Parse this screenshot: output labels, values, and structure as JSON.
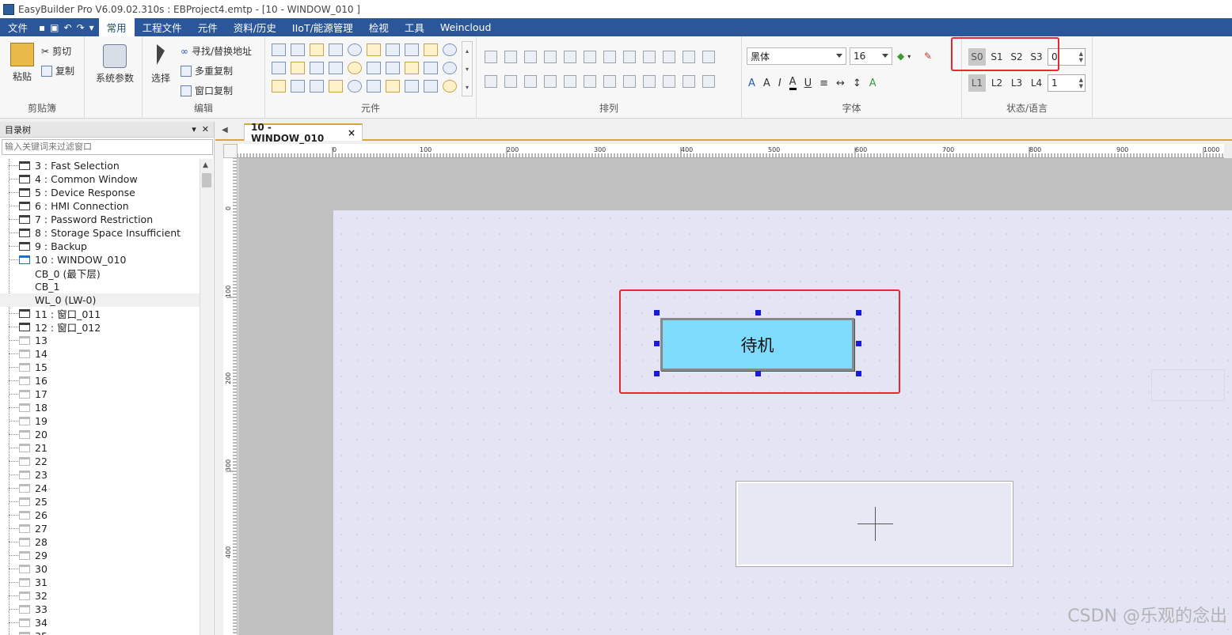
{
  "titlebar": {
    "title": "EasyBuilder Pro V6.09.02.310s : EBProject4.emtp - [10 - WINDOW_010 ]"
  },
  "menubar": {
    "file": "文件",
    "tabs": [
      {
        "label": "常用",
        "active": true
      },
      {
        "label": "工程文件"
      },
      {
        "label": "元件"
      },
      {
        "label": "资料/历史"
      },
      {
        "label": "IIoT/能源管理"
      },
      {
        "label": "检视"
      },
      {
        "label": "工具"
      },
      {
        "label": "Weincloud"
      }
    ]
  },
  "ribbon": {
    "clipboard": {
      "paste": "粘贴",
      "cut": "剪切",
      "copy": "复制",
      "label": "剪贴簿"
    },
    "system": {
      "params": "系统参数"
    },
    "edit": {
      "select": "选择",
      "find": "寻找/替换地址",
      "multi_copy": "多重复制",
      "window_copy": "窗口复制",
      "label": "编辑"
    },
    "objects": {
      "label": "元件"
    },
    "arrange": {
      "label": "排列"
    },
    "font": {
      "family": "黑体",
      "size": "16",
      "label": "字体"
    },
    "state": {
      "s0": "S0",
      "s1": "S1",
      "s2": "S2",
      "s3": "S3",
      "state_value": "0",
      "l1": "L1",
      "l2": "L2",
      "l3": "L3",
      "l4": "L4",
      "lang_value": "1",
      "label": "状态/语言"
    }
  },
  "tree_panel": {
    "title": "目录树",
    "filter_placeholder": "输入关键词来过滤窗口",
    "items": [
      {
        "label": "3 : Fast Selection"
      },
      {
        "label": "4 : Common Window"
      },
      {
        "label": "5 : Device Response"
      },
      {
        "label": "6 : HMI Connection"
      },
      {
        "label": "7 : Password Restriction"
      },
      {
        "label": "8 : Storage Space Insufficient"
      },
      {
        "label": "9 : Backup"
      },
      {
        "label": "10 : WINDOW_010"
      },
      {
        "label": "CB_0 (最下层)"
      },
      {
        "label": "CB_1"
      },
      {
        "label": "WL_0 (LW-0)"
      },
      {
        "label": "11 : 窗口_011"
      },
      {
        "label": "12 : 窗口_012"
      },
      {
        "label": "13"
      },
      {
        "label": "14"
      },
      {
        "label": "15"
      },
      {
        "label": "16"
      },
      {
        "label": "17"
      },
      {
        "label": "18"
      },
      {
        "label": "19"
      },
      {
        "label": "20"
      },
      {
        "label": "21"
      },
      {
        "label": "22"
      },
      {
        "label": "23"
      },
      {
        "label": "24"
      },
      {
        "label": "25"
      },
      {
        "label": "26"
      },
      {
        "label": "27"
      },
      {
        "label": "28"
      },
      {
        "label": "29"
      },
      {
        "label": "30"
      },
      {
        "label": "31"
      },
      {
        "label": "32"
      },
      {
        "label": "33"
      },
      {
        "label": "34"
      },
      {
        "label": "35"
      }
    ]
  },
  "doc_tab": {
    "label": "10 - WINDOW_010",
    "close": "×"
  },
  "ruler": {
    "top": [
      "0",
      "100",
      "200",
      "300",
      "400",
      "500",
      "600",
      "700",
      "800",
      "900",
      "1000"
    ],
    "left": [
      "0",
      "100",
      "200",
      "300",
      "400"
    ]
  },
  "canvas": {
    "button_label": "待机"
  },
  "watermark": "CSDN @乐观的念出",
  "colors": {
    "menubar": "#2b579a",
    "button_fill": "#7fdbfc",
    "highlight": "#e8282e",
    "handle": "#1a1adc",
    "page": "#e4e4f4"
  }
}
